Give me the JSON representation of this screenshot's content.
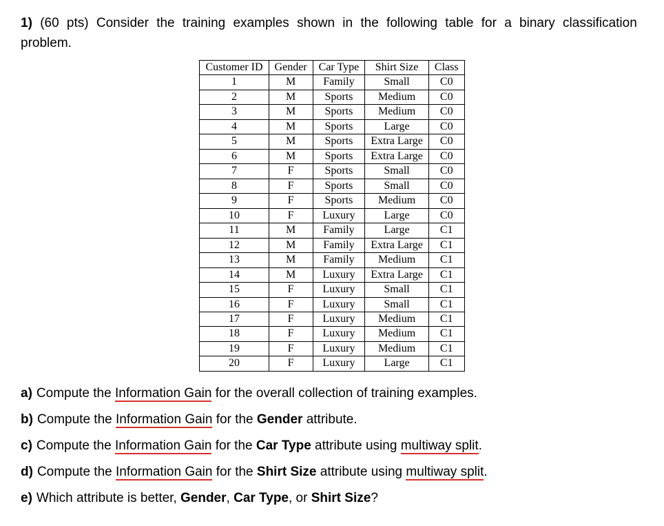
{
  "question": {
    "number": "1)",
    "points": "(60 pts)",
    "intro": "Consider the training examples shown in the following table for a binary classification problem."
  },
  "table": {
    "headers": [
      "Customer ID",
      "Gender",
      "Car Type",
      "Shirt Size",
      "Class"
    ],
    "rows": [
      [
        "1",
        "M",
        "Family",
        "Small",
        "C0"
      ],
      [
        "2",
        "M",
        "Sports",
        "Medium",
        "C0"
      ],
      [
        "3",
        "M",
        "Sports",
        "Medium",
        "C0"
      ],
      [
        "4",
        "M",
        "Sports",
        "Large",
        "C0"
      ],
      [
        "5",
        "M",
        "Sports",
        "Extra Large",
        "C0"
      ],
      [
        "6",
        "M",
        "Sports",
        "Extra Large",
        "C0"
      ],
      [
        "7",
        "F",
        "Sports",
        "Small",
        "C0"
      ],
      [
        "8",
        "F",
        "Sports",
        "Small",
        "C0"
      ],
      [
        "9",
        "F",
        "Sports",
        "Medium",
        "C0"
      ],
      [
        "10",
        "F",
        "Luxury",
        "Large",
        "C0"
      ],
      [
        "11",
        "M",
        "Family",
        "Large",
        "C1"
      ],
      [
        "12",
        "M",
        "Family",
        "Extra Large",
        "C1"
      ],
      [
        "13",
        "M",
        "Family",
        "Medium",
        "C1"
      ],
      [
        "14",
        "M",
        "Luxury",
        "Extra Large",
        "C1"
      ],
      [
        "15",
        "F",
        "Luxury",
        "Small",
        "C1"
      ],
      [
        "16",
        "F",
        "Luxury",
        "Small",
        "C1"
      ],
      [
        "17",
        "F",
        "Luxury",
        "Medium",
        "C1"
      ],
      [
        "18",
        "F",
        "Luxury",
        "Medium",
        "C1"
      ],
      [
        "19",
        "F",
        "Luxury",
        "Medium",
        "C1"
      ],
      [
        "20",
        "F",
        "Luxury",
        "Large",
        "C1"
      ]
    ]
  },
  "subparts": {
    "a": {
      "label": "a)",
      "t1": "Compute the ",
      "ig": "Information Gain",
      "t2": " for the overall collection of training examples."
    },
    "b": {
      "label": "b)",
      "t1": "Compute the ",
      "ig": "Information Gain",
      "t2": " for the ",
      "attr": "Gender",
      "t3": " attribute."
    },
    "c": {
      "label": "c)",
      "t1": "Compute the ",
      "ig": "Information Gain",
      "t2": " for the ",
      "attr": "Car Type",
      "t3": " attribute using ",
      "mw": "multiway split",
      "t4": "."
    },
    "d": {
      "label": "d)",
      "t1": "Compute the ",
      "ig": "Information Gain",
      "t2": " for the ",
      "attr": "Shirt Size",
      "t3": " attribute using ",
      "mw": "multiway split",
      "t4": "."
    },
    "e": {
      "label": "e)",
      "t1": "Which attribute is better, ",
      "a1": "Gender",
      "sep1": ", ",
      "a2": "Car Type",
      "sep2": ", or ",
      "a3": "Shirt Size",
      "t2": "?"
    }
  }
}
